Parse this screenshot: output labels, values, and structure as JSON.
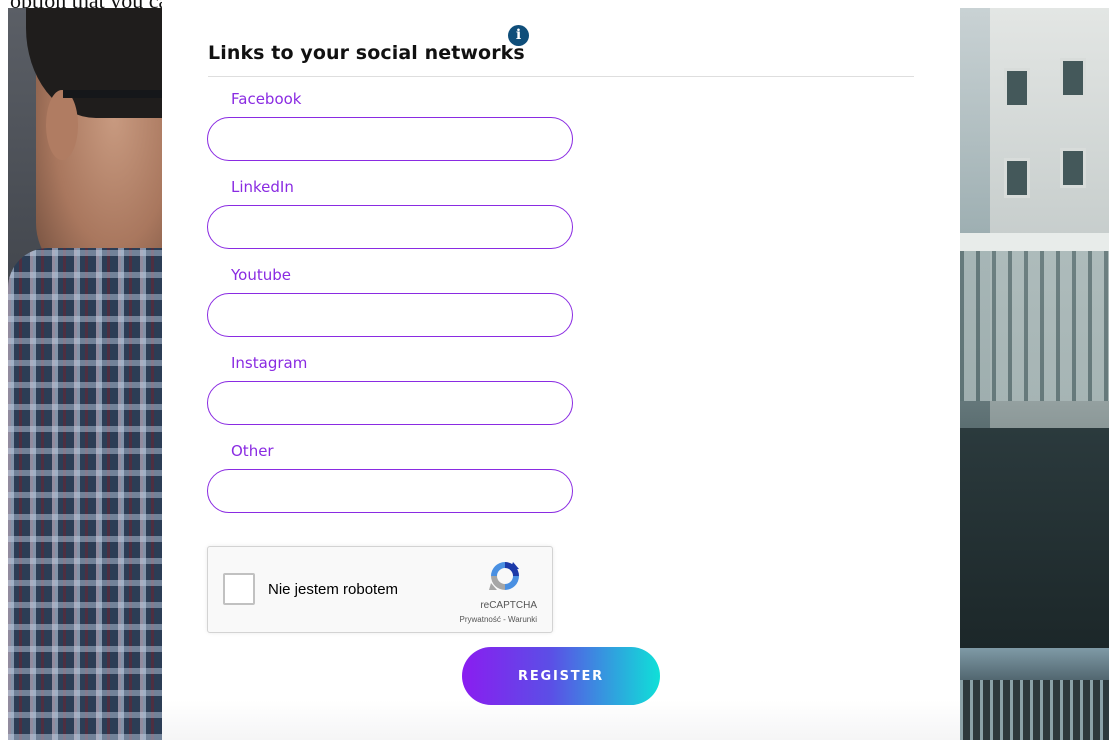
{
  "top_text": "option that you can use.",
  "section": {
    "title": "Links to your social networks",
    "info_icon": "info-icon"
  },
  "fields": [
    {
      "label": "Facebook",
      "value": "",
      "placeholder": ""
    },
    {
      "label": "LinkedIn",
      "value": "",
      "placeholder": ""
    },
    {
      "label": "Youtube",
      "value": "",
      "placeholder": ""
    },
    {
      "label": "Instagram",
      "value": "",
      "placeholder": ""
    },
    {
      "label": "Other",
      "value": "",
      "placeholder": ""
    }
  ],
  "recaptcha": {
    "checkbox_label": "Nie jestem robotem",
    "brand": "reCAPTCHA",
    "links": "Prywatność - Warunki",
    "icon": "recaptcha-logo-icon"
  },
  "register_button": {
    "label": "REGISTER"
  },
  "colors": {
    "accent": "#8a2be2",
    "info": "#0f4e7a",
    "gradient_start": "#8a1df0",
    "gradient_end": "#0fe0d8"
  }
}
